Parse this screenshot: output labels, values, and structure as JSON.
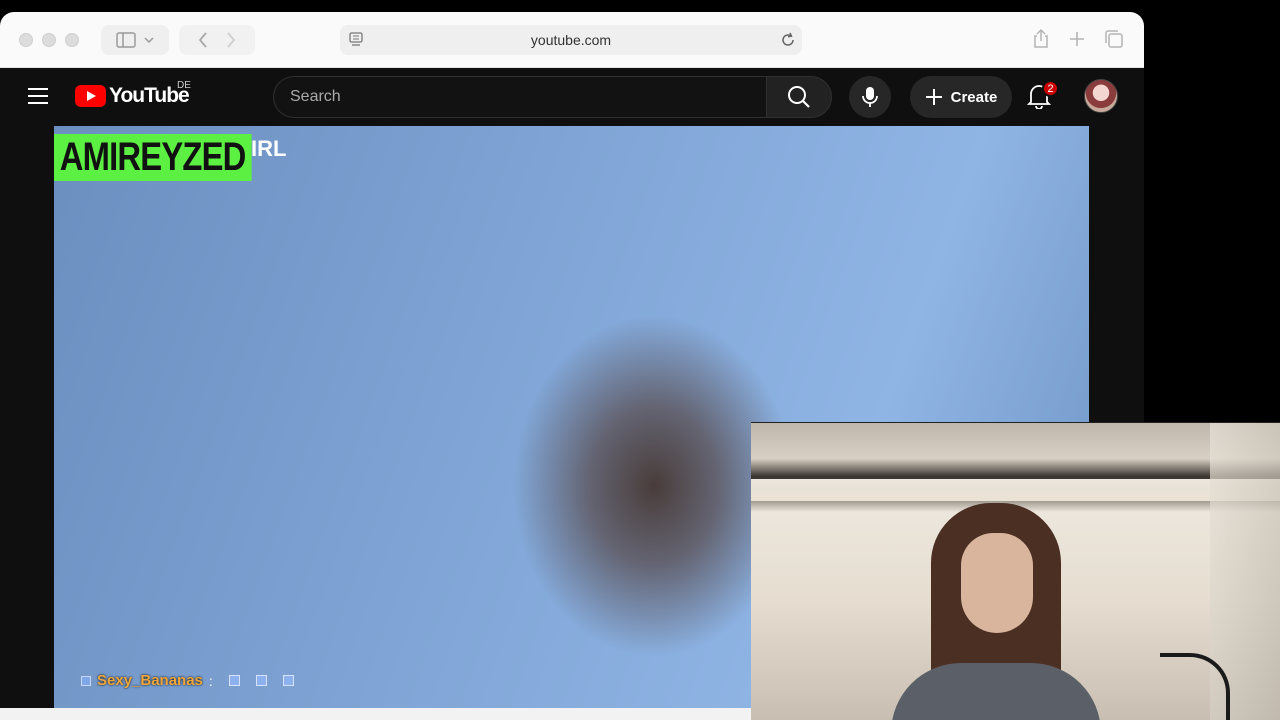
{
  "browser": {
    "url": "youtube.com"
  },
  "youtube": {
    "logo_text": "YouTube",
    "region": "DE",
    "search_placeholder": "Search",
    "create_label": "Create",
    "notification_count": "2"
  },
  "video": {
    "channel_name": "AMIREYZED",
    "channel_tag": "IRL",
    "chat_user": "Sexy_Bananas",
    "chat_separator": ":"
  },
  "colors": {
    "youtube_red": "#ff0000",
    "banner_green": "#5cf043",
    "chat_user_orange": "#f0a63a",
    "badge_red": "#cc0000"
  }
}
